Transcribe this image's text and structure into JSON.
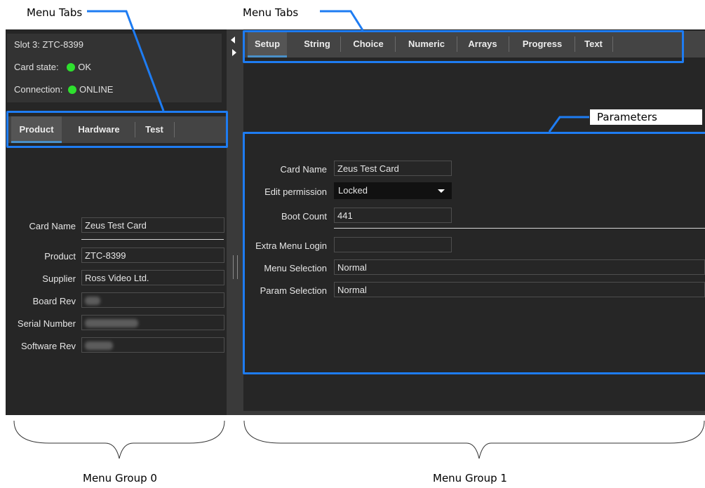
{
  "annotations": {
    "menu_tabs_left": "Menu Tabs",
    "menu_tabs_right": "Menu Tabs",
    "parameters": "Parameters",
    "menu_group_0": "Menu Group 0",
    "menu_group_1": "Menu Group 1"
  },
  "status": {
    "slot": "Slot 3: ZTC-8399",
    "card_state_label": "Card state:",
    "card_state_value": "OK",
    "connection_label": "Connection:",
    "connection_value": "ONLINE",
    "ok_color": "#2ee02e"
  },
  "left_tabs": [
    {
      "label": "Product",
      "active": true
    },
    {
      "label": "Hardware",
      "active": false
    },
    {
      "label": "Test",
      "active": false
    }
  ],
  "left_fields": {
    "card_name_label": "Card Name",
    "card_name_value": "Zeus Test Card",
    "product_label": "Product",
    "product_value": "ZTC-8399",
    "supplier_label": "Supplier",
    "supplier_value": "Ross Video Ltd.",
    "board_rev_label": "Board Rev",
    "serial_label": "Serial Number",
    "software_rev_label": "Software Rev"
  },
  "right_tabs": [
    {
      "label": "Setup",
      "active": true
    },
    {
      "label": "String",
      "active": false
    },
    {
      "label": "Choice",
      "active": false
    },
    {
      "label": "Numeric",
      "active": false
    },
    {
      "label": "Arrays",
      "active": false
    },
    {
      "label": "Progress",
      "active": false
    },
    {
      "label": "Text",
      "active": false
    }
  ],
  "params": {
    "card_name_label": "Card Name",
    "card_name_value": "Zeus Test Card",
    "edit_permission_label": "Edit permission",
    "edit_permission_value": "Locked",
    "boot_count_label": "Boot Count",
    "boot_count_value": "441",
    "extra_menu_login_label": "Extra Menu Login",
    "extra_menu_login_value": "",
    "menu_selection_label": "Menu Selection",
    "menu_selection_value": "Normal",
    "param_selection_label": "Param Selection",
    "param_selection_value": "Normal"
  },
  "colors": {
    "highlight_box": "#1e7cf2",
    "tab_accent": "#4a90c8"
  }
}
